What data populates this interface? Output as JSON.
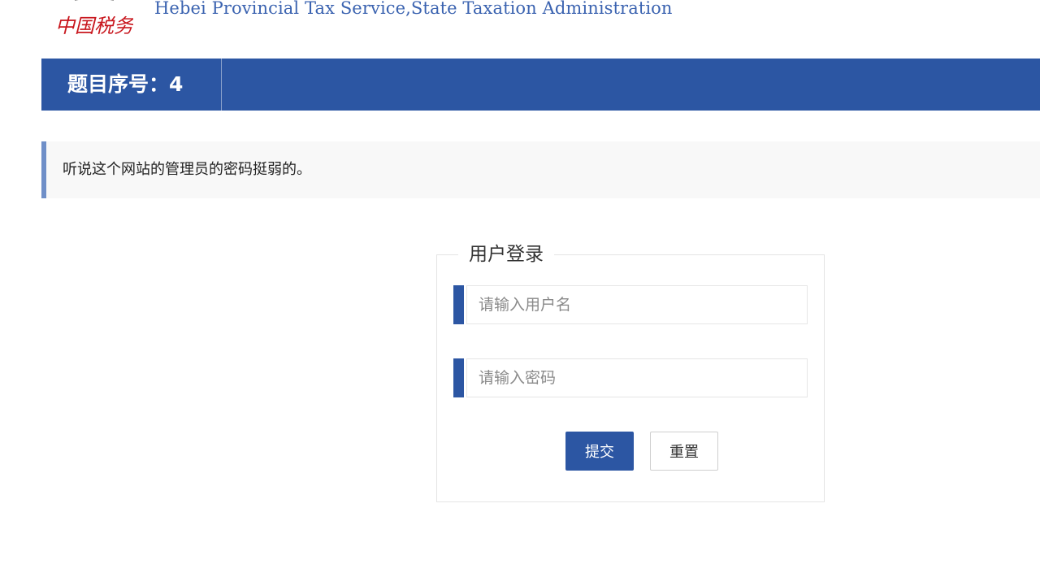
{
  "header": {
    "site_title": "Hebei Provincial Tax Service,State Taxation Administration",
    "logo_text": "中国税务"
  },
  "topbar": {
    "title": "题目序号：4"
  },
  "notice": {
    "text": "听说这个网站的管理员的密码挺弱的。"
  },
  "login": {
    "legend": "用户登录",
    "username_placeholder": "请输入用户名",
    "username_value": "",
    "password_placeholder": "请输入密码",
    "password_value": "",
    "submit_label": "提交",
    "reset_label": "重置"
  },
  "colors": {
    "brand_blue": "#2c56a3",
    "title_blue": "#3b63b0",
    "logo_red": "#c8161d",
    "notice_border": "#6f8fc8"
  }
}
